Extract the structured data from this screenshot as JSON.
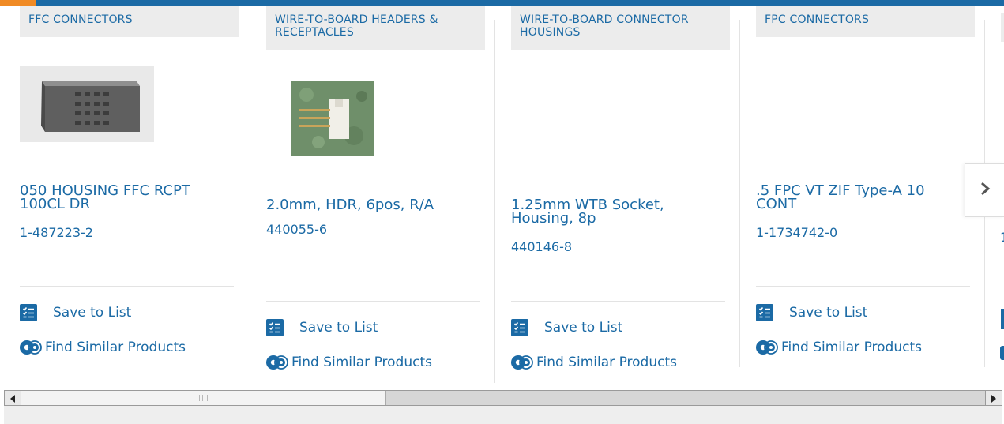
{
  "products": [
    {
      "category": "FFC CONNECTORS",
      "title": "050 HOUSING FFC RCPT\n100CL DR",
      "part_number": "1-487223-2",
      "image": "gray-rectangular-housing",
      "save_label": "Save to List",
      "similar_label": "Find Similar Products"
    },
    {
      "category": "WIRE-TO-BOARD HEADERS &\nRECEPTACLES",
      "title": "2.0mm, HDR, 6pos, R/A",
      "part_number": "440055-6",
      "image": "white-header-on-green",
      "save_label": "Save to List",
      "similar_label": "Find Similar Products"
    },
    {
      "category": "WIRE-TO-BOARD CONNECTOR\nHOUSINGS",
      "title": "1.25mm WTB Socket,\nHousing, 8p",
      "part_number": "440146-8",
      "image": "",
      "save_label": "Save to List",
      "similar_label": "Find Similar Products"
    },
    {
      "category": "FPC CONNECTORS",
      "title": ".5 FPC VT ZIF Type-A 10\nCONT",
      "part_number": "1-1734742-0",
      "image": "",
      "save_label": "Save to List",
      "similar_label": "Find Similar Products"
    }
  ],
  "carousel_next_icon": "chevron-right-icon",
  "peek_part_prefix": "1",
  "colors": {
    "brand_blue": "#1b6aa5",
    "accent_orange": "#f08a24",
    "category_bg": "#ececec"
  },
  "scrollbar": {
    "left_icon": "scroll-left-arrow-icon",
    "right_icon": "scroll-right-arrow-icon"
  }
}
